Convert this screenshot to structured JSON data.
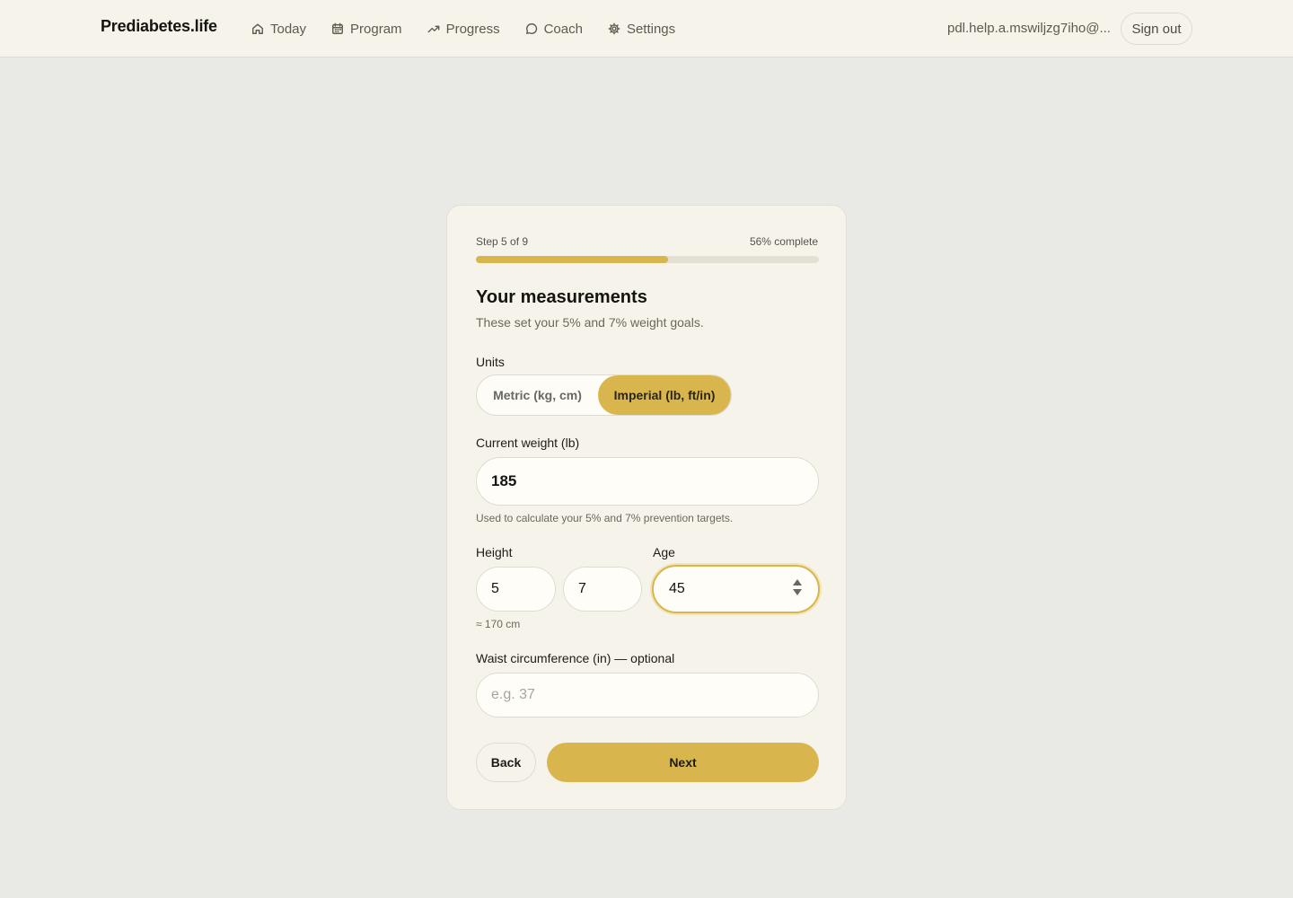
{
  "header": {
    "brand": "Prediabetes.life",
    "nav": [
      {
        "label": "Today",
        "icon": "home-icon"
      },
      {
        "label": "Program",
        "icon": "calendar-icon"
      },
      {
        "label": "Progress",
        "icon": "trending-up-icon"
      },
      {
        "label": "Coach",
        "icon": "chat-bubble-icon"
      },
      {
        "label": "Settings",
        "icon": "gear-icon"
      }
    ],
    "email": "pdl.help.a.mswiljzg7iho@...",
    "sign_out": "Sign out"
  },
  "progress": {
    "step_text": "Step 5 of 9",
    "percent_text": "56% complete",
    "percent": 56
  },
  "form": {
    "title": "Your measurements",
    "subtitle": "These set your 5% and 7% weight goals.",
    "units_label": "Units",
    "unit_options": [
      "Metric (kg, cm)",
      "Imperial (lb, ft/in)"
    ],
    "selected_unit": "Imperial (lb, ft/in)",
    "weight_label": "Current weight (lb)",
    "weight_value": "185",
    "weight_hint": "Used to calculate your 5% and 7% prevention targets.",
    "height_label": "Height",
    "height_ft": "5",
    "height_in": "7",
    "height_cm_hint": "≈ 170 cm",
    "age_label": "Age",
    "age_value": "45",
    "waist_label": "Waist circumference (in) — optional",
    "waist_placeholder": "e.g. 37",
    "back": "Back",
    "next": "Next"
  },
  "colors": {
    "accent": "#d9b64d",
    "background": "#e9eae5",
    "card": "#f6f4ea"
  }
}
